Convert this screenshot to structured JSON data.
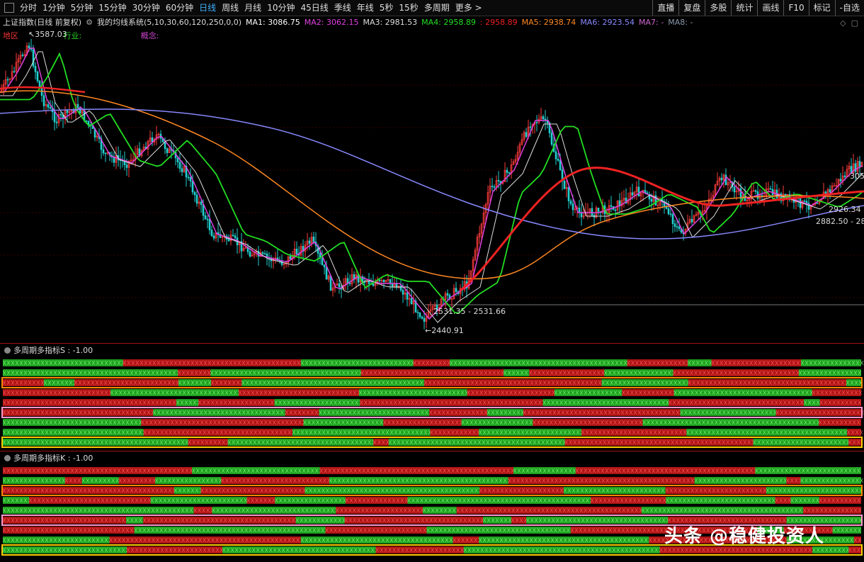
{
  "toolbar": {
    "periods": [
      "分时",
      "1分钟",
      "5分钟",
      "15分钟",
      "30分钟",
      "60分钟",
      "日线",
      "周线",
      "月线",
      "10分钟",
      "45日线",
      "季线",
      "年线",
      "5秒",
      "15秒",
      "多周期",
      "更多 >"
    ],
    "active_period": "日线",
    "right_tools": [
      "直播",
      "复盘",
      "多股",
      "统计",
      "画线",
      "F10",
      "标记",
      "-自选"
    ]
  },
  "info": {
    "title": "上证指数(日线 前复权)",
    "indicator": "我的均线系统(5,10,30,60,120,250,0,0)",
    "ma": [
      {
        "label": "MA1: 3086.75",
        "color": "#ffffff"
      },
      {
        "label": "MA2: 3062.15",
        "color": "#e040e0"
      },
      {
        "label": "MA3: 2981.53",
        "color": "#dddddd"
      },
      {
        "label": "MA4: 2958.89",
        "color": "#22dd22"
      },
      {
        "label": ": 2958.89",
        "color": "#ee2222"
      },
      {
        "label": "MA5: 2938.74",
        "color": "#ff8822"
      },
      {
        "label": "MA6: 2923.54",
        "color": "#8888ff"
      },
      {
        "label": "MA7: -",
        "color": "#cc66cc"
      },
      {
        "label": "MA8: -",
        "color": "#8899aa"
      }
    ]
  },
  "tags": {
    "region": "地区",
    "industry": "行业:",
    "concept": "概念:"
  },
  "annotations": {
    "high": "3587.03",
    "range1": "2531.35 - 2531.66",
    "low": "2440.91",
    "right1": "2926.34",
    "right2": "2882.50 - 28",
    "right3": "305"
  },
  "panels": [
    {
      "title": "多周期多指标S : -1.00"
    },
    {
      "title": "多周期多指标K : -1.00"
    }
  ],
  "watermark": "头条 @稳健投资人",
  "colors": {
    "up": "#ff3b3b",
    "down": "#22d0d0",
    "green_band": "#1fa01f",
    "red_band": "#b01414"
  }
}
